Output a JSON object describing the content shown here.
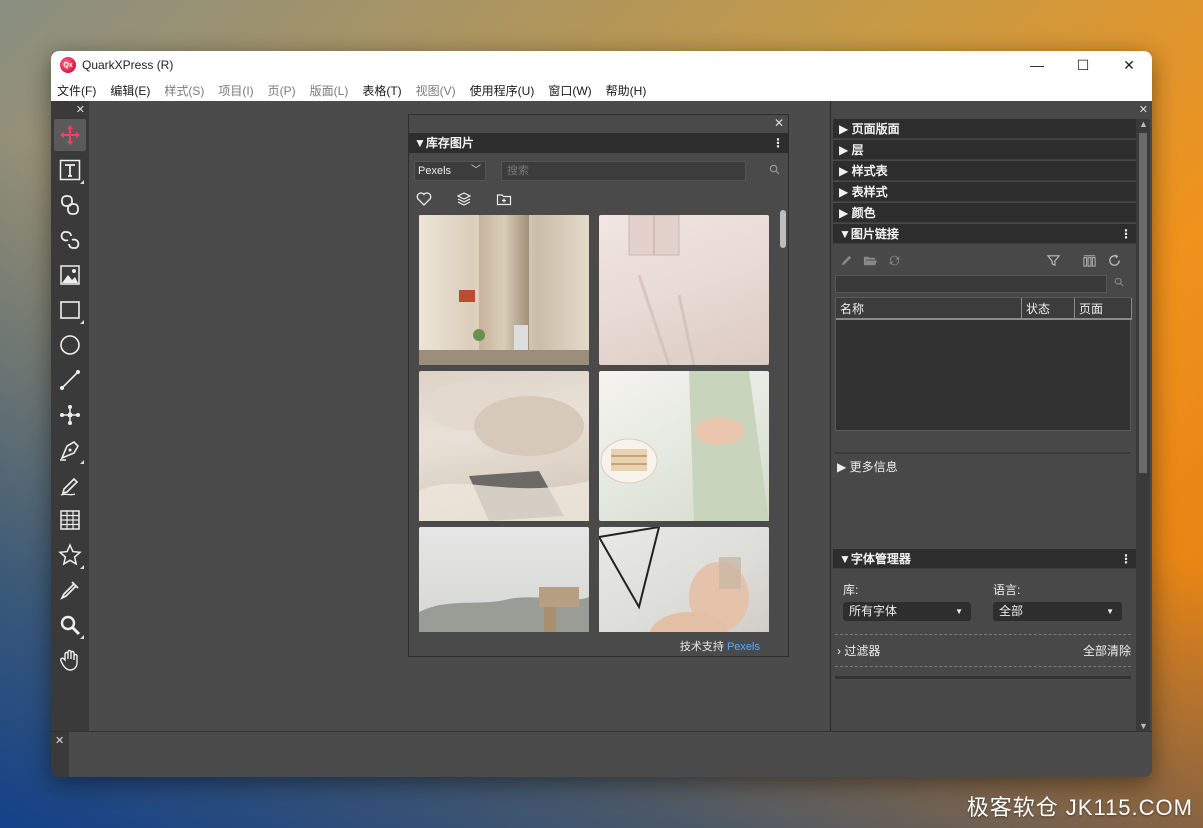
{
  "window": {
    "title": "QuarkXPress (R)",
    "logo_text": "Qx",
    "minimize": "—",
    "maximize": "☐",
    "close": "✕"
  },
  "menu": [
    {
      "label": "文件(F)",
      "enabled": true
    },
    {
      "label": "编辑(E)",
      "enabled": true
    },
    {
      "label": "样式(S)",
      "enabled": false
    },
    {
      "label": "项目(I)",
      "enabled": false
    },
    {
      "label": "页(P)",
      "enabled": false
    },
    {
      "label": "版面(L)",
      "enabled": false
    },
    {
      "label": "表格(T)",
      "enabled": true
    },
    {
      "label": "视图(V)",
      "enabled": false
    },
    {
      "label": "使用程序(U)",
      "enabled": true
    },
    {
      "label": "窗口(W)",
      "enabled": true
    },
    {
      "label": "帮助(H)",
      "enabled": true
    }
  ],
  "tools": [
    {
      "icon": "move-icon",
      "active": true
    },
    {
      "icon": "text-box-icon",
      "active": false
    },
    {
      "icon": "text-linking-icon",
      "active": false
    },
    {
      "icon": "text-unlinking-icon",
      "active": false
    },
    {
      "icon": "picture-box-icon",
      "active": false
    },
    {
      "icon": "rectangle-box-icon",
      "active": false
    },
    {
      "icon": "oval-box-icon",
      "active": false
    },
    {
      "icon": "line-icon",
      "active": false
    },
    {
      "icon": "bezier-icon",
      "active": false
    },
    {
      "icon": "pen-icon",
      "active": false
    },
    {
      "icon": "freehand-icon",
      "active": false
    },
    {
      "icon": "table-icon",
      "active": false
    },
    {
      "icon": "star-icon",
      "active": false
    },
    {
      "icon": "eyedropper-icon",
      "active": false
    },
    {
      "icon": "zoom-icon",
      "active": false
    },
    {
      "icon": "pan-icon",
      "active": false
    }
  ],
  "stock": {
    "title": "▼库存图片",
    "source": "Pexels",
    "search_placeholder": "搜索",
    "credit_prefix": "技术支持",
    "credit_link": "Pexels"
  },
  "right_panels": {
    "collapsed": [
      "▶ 页面版面",
      "▶ 层",
      "▶ 样式表",
      "▶ 表样式",
      "▶ 颜色"
    ],
    "links_title": "▼图片链接",
    "links_columns": [
      "名称",
      "状态",
      "页面"
    ],
    "more_info": "▶ 更多信息",
    "font_manager_title": "▼字体管理器",
    "library_label": "库:",
    "library_value": "所有字体",
    "language_label": "语言:",
    "language_value": "全部",
    "filter_label": "› 过滤器",
    "clear_all": "全部清除"
  },
  "watermark": "极客软仓 JK115.COM"
}
